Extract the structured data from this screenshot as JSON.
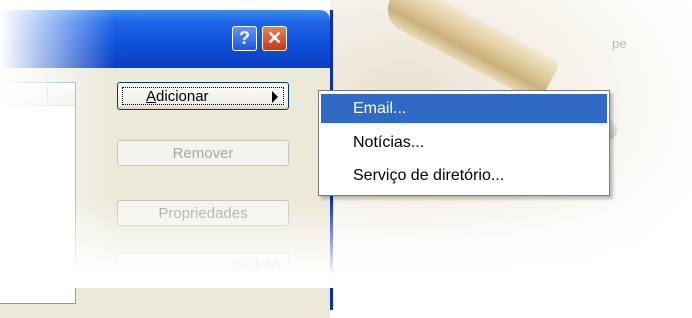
{
  "background": {
    "text": "pe"
  },
  "window": {
    "title_buttons": {
      "help_label": "?",
      "close_label": "✕"
    }
  },
  "buttons": {
    "add_prefix": "A",
    "add_rest": "dicionar",
    "remove_label": "Remover",
    "properties_label": "Propriedades",
    "extra_label": "padrão"
  },
  "menu": {
    "items": [
      {
        "label": "Email...",
        "selected": true
      },
      {
        "label": "Notícias...",
        "selected": false
      },
      {
        "label": "Serviço de diretório...",
        "selected": false
      }
    ]
  },
  "colors": {
    "selection": "#316ac5",
    "titlebar": "#0f4fd8",
    "dialog_face": "#ece9d8"
  }
}
